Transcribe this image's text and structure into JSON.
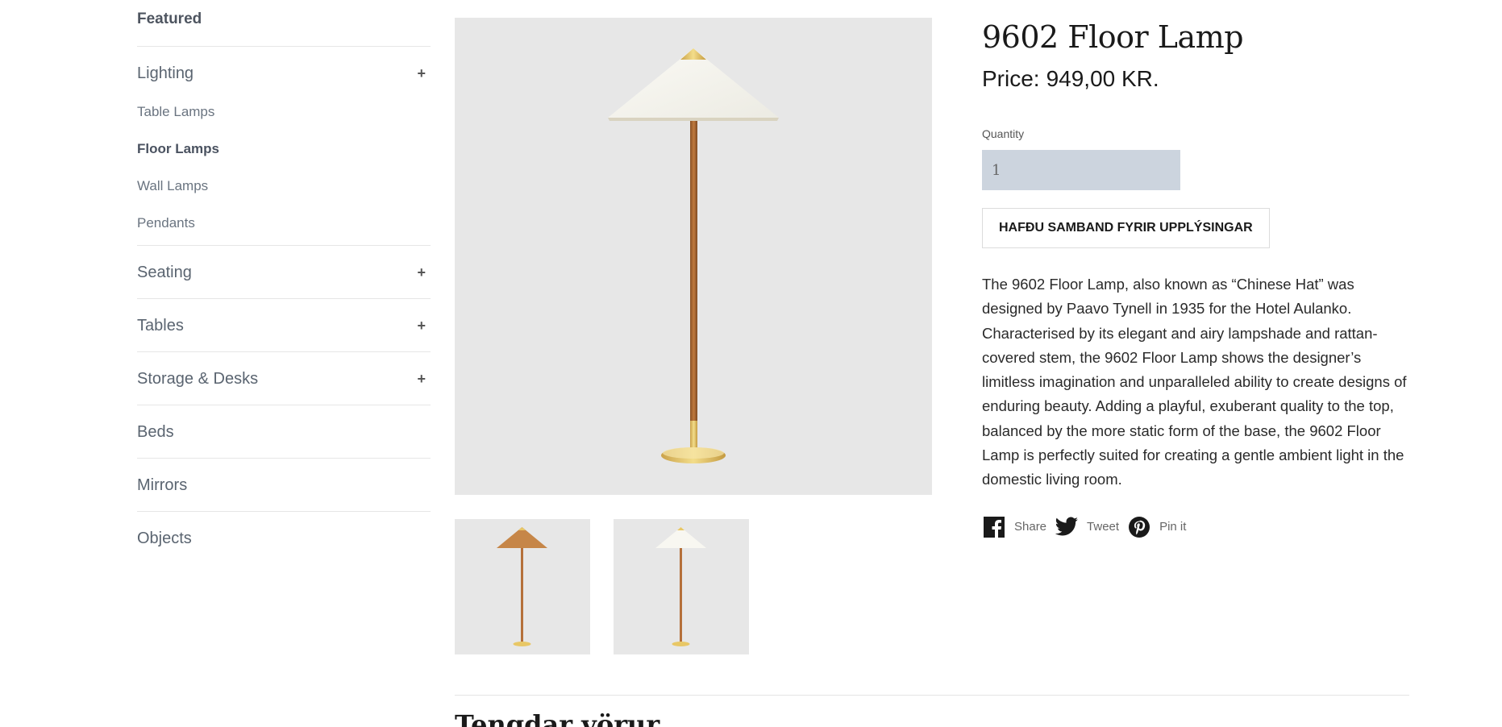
{
  "sidebar": {
    "featured": "Featured",
    "lighting": {
      "label": "Lighting",
      "toggle": "+"
    },
    "lighting_sub": [
      "Table Lamps",
      "Floor Lamps",
      "Wall Lamps",
      "Pendants"
    ],
    "categories": [
      {
        "label": "Seating",
        "toggle": "+"
      },
      {
        "label": "Tables",
        "toggle": "+"
      },
      {
        "label": "Storage & Desks",
        "toggle": "+"
      },
      {
        "label": "Beds"
      },
      {
        "label": "Mirrors"
      },
      {
        "label": "Objects"
      }
    ]
  },
  "product": {
    "title": "9602 Floor Lamp",
    "price_label": "Price:",
    "price_value": "949,00 KR.",
    "quantity_label": "Quantity",
    "quantity_value": "1",
    "contact_button": "HAFÐU SAMBAND FYRIR UPPLÝSINGAR",
    "description": "The 9602 Floor Lamp, also known as “Chinese Hat” was designed by Paavo Tynell in 1935 for the Hotel Aulanko. Characterised by its elegant and airy lampshade and rattan-covered stem, the 9602 Floor Lamp shows the designer’s limitless imagination and unparalleled ability to create designs of enduring beauty. Adding a playful, exuberant quality to the top, balanced by the more static form of the base, the 9602 Floor Lamp is perfectly suited for creating a gentle ambient light in the domestic living room."
  },
  "social": {
    "share": "Share",
    "tweet": "Tweet",
    "pin": "Pin it"
  },
  "related": {
    "title": "Tengdar vörur"
  },
  "icons": {
    "facebook": "facebook-icon",
    "twitter": "twitter-icon",
    "pinterest": "pinterest-icon"
  },
  "colors": {
    "image_bg": "#e7e7e7",
    "quantity_bg": "#ccd4de",
    "brass": "#e8c766",
    "rattan": "#b5703a"
  }
}
